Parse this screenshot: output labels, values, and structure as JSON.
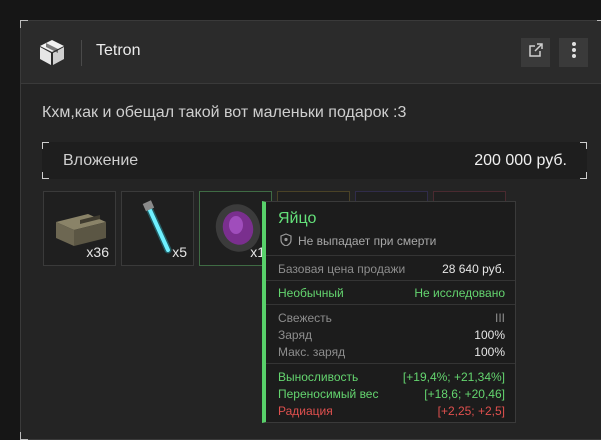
{
  "window": {
    "title": "Tetron"
  },
  "icons": {
    "app": "package-box-icon",
    "external": "external-link-icon",
    "menu": "kebab-menu-icon",
    "shield": "shield-icon"
  },
  "message": {
    "text": "Кхм,как и обещал такой вот маленьки подарок :3"
  },
  "attachment": {
    "label": "Вложение",
    "value": "200 000 руб."
  },
  "items": [
    {
      "name": "crate",
      "qty": "x36"
    },
    {
      "name": "glowstick",
      "qty": "x5"
    },
    {
      "name": "egg",
      "qty": "x1"
    },
    {
      "name": "hidden-item-1",
      "qty": ""
    },
    {
      "name": "hidden-item-2",
      "qty": ""
    },
    {
      "name": "hidden-item-3",
      "qty": ""
    }
  ],
  "tooltip": {
    "name": "Яйцо",
    "no_drop": "Не выпадает при смерти",
    "base_price_label": "Базовая цена продажи",
    "base_price_value": "28 640 руб.",
    "rarity": "Необычный",
    "research_status": "Не исследовано",
    "freshness_label": "Свежесть",
    "freshness_value": "III",
    "charge_label": "Заряд",
    "charge_value": "100%",
    "max_charge_label": "Макс. заряд",
    "max_charge_value": "100%",
    "stats": [
      {
        "label": "Выносливость",
        "value": "[+19,4%; +21,34%]"
      },
      {
        "label": "Переносимый вес",
        "value": "[+18,6; +20,46]"
      },
      {
        "label": "Радиация",
        "value": "[+2,25; +2,5]"
      }
    ]
  },
  "colors": {
    "accent_green": "#58d06a",
    "negative_red": "#e0504e",
    "background": "#242424"
  }
}
